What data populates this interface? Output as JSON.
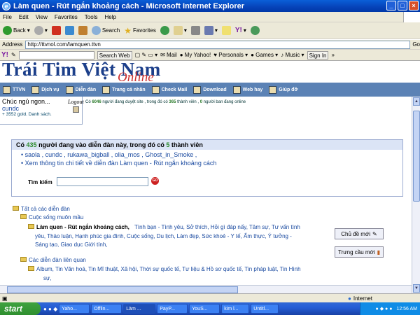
{
  "window": {
    "title": "Làm quen - Rút ngắn khoảng cách - Microsoft Internet Explorer"
  },
  "menu": [
    "File",
    "Edit",
    "View",
    "Favorites",
    "Tools",
    "Help"
  ],
  "toolbar": {
    "back": "Back",
    "search": "Search",
    "favorites": "Favorites"
  },
  "address": {
    "label": "Address",
    "url": "http://ttvnol.com/lamquen.ttvn",
    "go": "Go"
  },
  "yahoo_toolbar": {
    "search_button": "Search Web",
    "mail": "Mail",
    "myyahoo": "My Yahoo!",
    "personals": "Personals",
    "games": "Games",
    "music": "Music",
    "signin": "Sign In"
  },
  "logo": {
    "line1": "Trái Tim Việt Nam",
    "line2": "Online"
  },
  "nav": [
    "TTVN",
    "Dịch vụ",
    "Diễn đàn",
    "Trang cá nhân",
    "Check Mail",
    "Download",
    "Web hay",
    "Giúp đỡ"
  ],
  "user": {
    "greeting": "Chúc ngủ ngon...",
    "name": "cundc",
    "gold": "+ 3552 gold. Danh sách.",
    "logout": "Logout"
  },
  "status_line": {
    "prefix": "Có",
    "online": "6046",
    "mid": "người đang duyệt site , trong đó có",
    "members": "365",
    "mid2": "thành viên ,",
    "hidden": "0",
    "suffix": "người ban đang online"
  },
  "online_panel": {
    "heading_prefix": "Có",
    "heading_count": "435",
    "heading_mid": "người đang vào diễn đàn này, trong đó có",
    "heading_members": "5",
    "heading_suffix": "thành viên",
    "users_line": "saola , cundc , rukawa_bigball , olia_mos , Ghost_in_Smoke ,",
    "details_link": "Xem thông tin chi tiết về diễn đàn Làm quen - Rút ngắn khoảng cách",
    "search_label": "Tìm kiếm",
    "search_go": "GO"
  },
  "tree": {
    "all": "Tất cả các diễn đàn",
    "group1": "Cuộc sống muôn mầu",
    "current": "Làm quen - Rút ngắn khoảng cách,",
    "current_subs1": "Tình bạn - Tình yêu, Sở thích, Hỏi gì đáp nấy, Tâm sự, Tư vấn tình",
    "current_subs2": "yêu, Thảo luận, Hạnh phúc gia đình, Cuộc sống, Du lịch, Làm đẹp, Sức khoẻ - Y tế, Ẩm thực, Ý tưởng -",
    "current_subs3": "Sáng tạo, Giao dục Giới tính,",
    "group2": "Các diễn đàn liên quan",
    "related1": "Album, Tin Văn hoá, Tin Mĩ thuật, Xã hội, Thời sự quốc tế, Tư liệu & Hồ sơ quốc tế, Tin pháp luật, Tin Hình",
    "related2": "sự,"
  },
  "buttons": {
    "new_topic": "Chủ đề mới",
    "new_poll": "Trưng cầu mới"
  },
  "statusbar": {
    "zone": "Internet"
  },
  "taskbar": {
    "start": "start",
    "tasks": [
      "Yaho...",
      "Offlin...",
      "Làm ...",
      "PayP...",
      "YouS...",
      "kim l...",
      "Untitl..."
    ],
    "clock": "12:56 AM"
  }
}
